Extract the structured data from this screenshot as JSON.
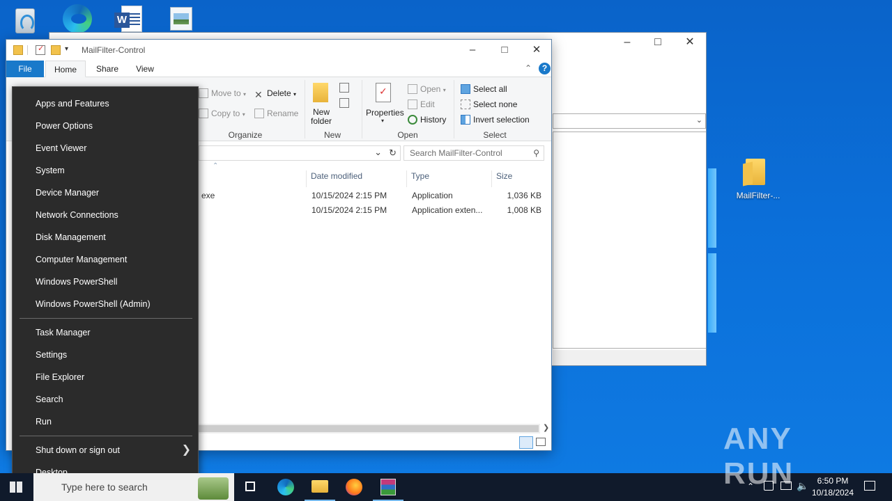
{
  "desktop": {
    "folder_label": "MailFilter-..."
  },
  "explorer": {
    "title": "MailFilter-Control",
    "tabs": [
      "File",
      "Home",
      "Share",
      "View"
    ],
    "ribbon": {
      "organize": {
        "move_to": "Move to",
        "copy_to": "Copy to",
        "delete": "Delete",
        "rename": "Rename",
        "label": "Organize"
      },
      "new": {
        "new_folder_line1": "New",
        "new_folder_line2": "folder",
        "label": "New"
      },
      "open": {
        "properties": "Properties",
        "open": "Open",
        "edit": "Edit",
        "history": "History",
        "label": "Open"
      },
      "select": {
        "select_all": "Select all",
        "select_none": "Select none",
        "invert_selection": "Invert selection",
        "label": "Select"
      }
    },
    "search_placeholder": "Search MailFilter-Control",
    "columns": [
      "Date modified",
      "Type",
      "Size"
    ],
    "rows": [
      {
        "name": "exe",
        "date": "10/15/2024 2:15 PM",
        "type": "Application",
        "size": "1,036 KB"
      },
      {
        "name": "",
        "date": "10/15/2024 2:15 PM",
        "type": "Application exten...",
        "size": "1,008 KB"
      }
    ]
  },
  "winx_menu": {
    "items": [
      "Apps and Features",
      "Power Options",
      "Event Viewer",
      "System",
      "Device Manager",
      "Network Connections",
      "Disk Management",
      "Computer Management",
      "Windows PowerShell",
      "Windows PowerShell (Admin)"
    ],
    "items2": [
      "Task Manager",
      "Settings",
      "File Explorer",
      "Search",
      "Run"
    ],
    "shutdown": "Shut down or sign out",
    "desktop": "Desktop"
  },
  "taskbar": {
    "search_placeholder": "Type here to search",
    "time": "6:50 PM",
    "date": "10/18/2024"
  },
  "watermark": "ANY RUN",
  "colors": {
    "accent": "#1979ca",
    "menu_bg": "#2b2b2b",
    "taskbar_bg": "#101a2b"
  }
}
